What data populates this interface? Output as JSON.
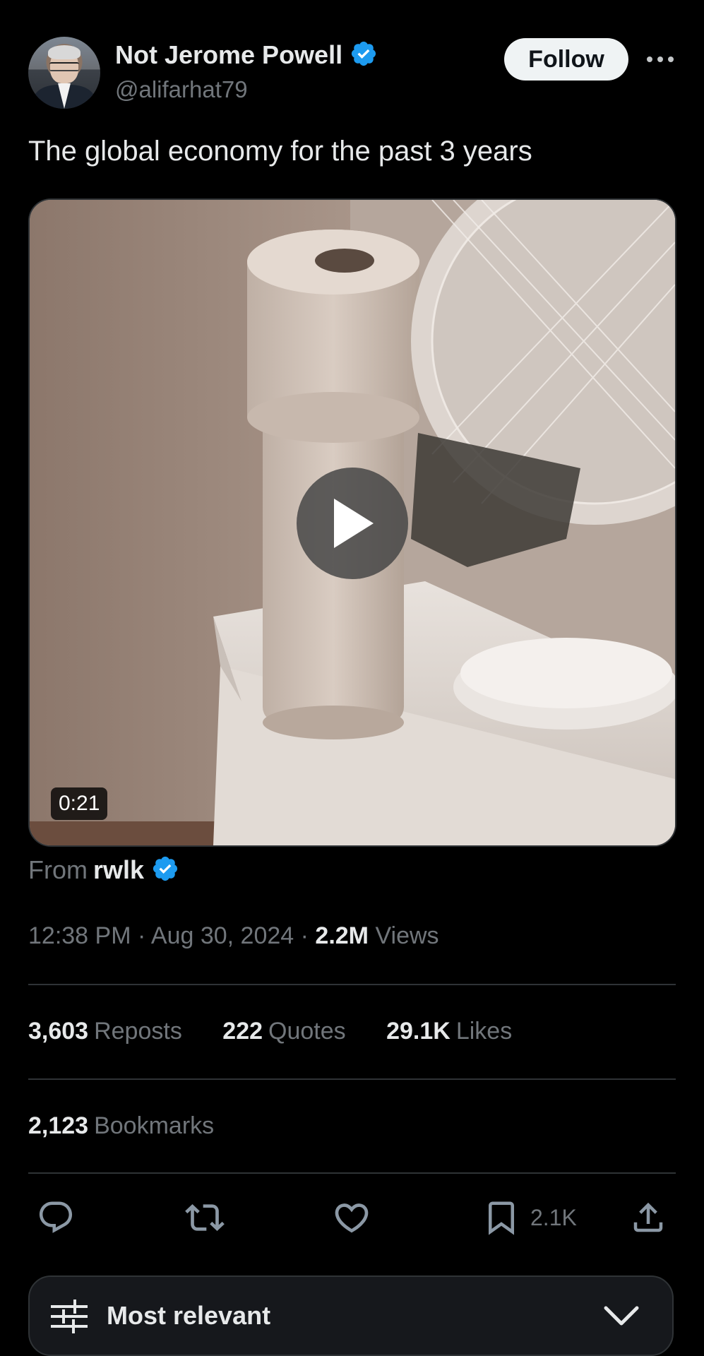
{
  "author": {
    "display_name": "Not Jerome Powell",
    "handle": "@alifarhat79",
    "verified": true
  },
  "header": {
    "follow_label": "Follow"
  },
  "tweet": {
    "text": "The global economy for the past 3 years"
  },
  "media": {
    "duration": "0:21",
    "from_prefix": "From",
    "from_user": "rwlk"
  },
  "meta": {
    "time": "12:38 PM",
    "separator": "·",
    "date": "Aug 30, 2024",
    "views_count": "2.2M",
    "views_label": "Views"
  },
  "stats": [
    {
      "count": "3,603",
      "label": "Reposts"
    },
    {
      "count": "222",
      "label": "Quotes"
    },
    {
      "count": "29.1K",
      "label": "Likes"
    }
  ],
  "bookmarks": {
    "count": "2,123",
    "label": "Bookmarks"
  },
  "actions": {
    "bookmark_count": "2.1K"
  },
  "sort": {
    "label": "Most relevant"
  },
  "colors": {
    "background": "#000000",
    "verified_blue": "#1d9bf0",
    "muted_text": "#71767b",
    "divider": "#2f3336"
  }
}
